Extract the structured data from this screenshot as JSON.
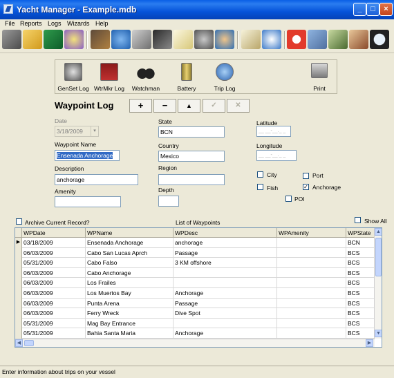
{
  "window": {
    "title": "Yacht Manager - Example.mdb",
    "minimize": "_",
    "maximize": "□",
    "close": "×"
  },
  "menu": [
    "File",
    "Reports",
    "Logs",
    "Wizards",
    "Help"
  ],
  "toolbar_icons": [
    "book-icon",
    "folder-icon",
    "save-icon",
    "star-icon",
    "brush-icon",
    "globe-icon",
    "tools-icon",
    "phone-icon",
    "notepad-icon",
    "engine-icon",
    "people-icon",
    "clipboard-icon",
    "clock-icon",
    "lifebuoy-icon",
    "printer-icon",
    "cash-icon",
    "house-icon",
    "magnifier-icon"
  ],
  "subtoolbar": [
    {
      "label": "GenSet Log",
      "icon": "genset-icon"
    },
    {
      "label": "WtrMkr Log",
      "icon": "watermaker-icon"
    },
    {
      "label": "Watchman",
      "icon": "binoculars-icon"
    },
    {
      "label": "Battery",
      "icon": "battery-icon"
    },
    {
      "label": "Trip Log",
      "icon": "globe-icon"
    },
    {
      "label": "Print",
      "icon": "printer-icon"
    }
  ],
  "form": {
    "heading": "Waypoint Log",
    "nav": {
      "add": "+",
      "delete": "−",
      "up": "▲",
      "check": "✓",
      "cancel": "✕"
    },
    "date_label": "Date",
    "date_value": "3/18/2009",
    "waypoint_label": "Waypoint Name",
    "waypoint_value": "Ensenada Anchorage",
    "description_label": "Description",
    "description_value": "anchorage",
    "amenity_label": "Amenity",
    "amenity_value": "",
    "state_label": "State",
    "state_value": "BCN",
    "country_label": "Country",
    "country_value": "Mexico",
    "region_label": "Region",
    "region_value": "",
    "depth_label": "Depth",
    "depth_value": "",
    "latitude_label": "Latitude",
    "latitude_value": "__ __-__._ _",
    "longitude_label": "Longitude",
    "longitude_value": "__ __-__._ _",
    "checks": {
      "city": "City",
      "port": "Port",
      "fish": "Fish",
      "anchorage": "Anchorage",
      "poi": "POI",
      "anchorage_mark": "✓"
    }
  },
  "grid": {
    "archive_label": "Archive Current Record?",
    "title": "List of Waypoints",
    "show_all": "Show All",
    "columns": [
      "WPDate",
      "WPName",
      "WPDesc",
      "WPAmenity",
      "WPState"
    ],
    "current_marker": "▶",
    "rows": [
      [
        "03/18/2009",
        "Ensenada Anchorage",
        "anchorage",
        "",
        "BCN"
      ],
      [
        "06/03/2009",
        "Cabo San Lucas Aprch",
        "Passage",
        "",
        "BCS"
      ],
      [
        "05/31/2009",
        "Cabo Falso",
        "3 KM offshore",
        "",
        "BCS"
      ],
      [
        "06/03/2009",
        "Cabo Anchorage",
        "",
        "",
        "BCS"
      ],
      [
        "06/03/2009",
        "Los Frailes",
        "",
        "",
        "BCS"
      ],
      [
        "06/03/2009",
        "Los Muertos Bay",
        "Anchorage",
        "",
        "BCS"
      ],
      [
        "06/03/2009",
        "Punta Arena",
        "Passage",
        "",
        "BCS"
      ],
      [
        "06/03/2009",
        "Ferry Wreck",
        "Dive Spot",
        "",
        "BCS"
      ],
      [
        "05/31/2009",
        "Mag Bay Entrance",
        "",
        "",
        "BCS"
      ],
      [
        "05/31/2009",
        "Bahia Santa Maria",
        "Anchorage",
        "",
        "BCS"
      ]
    ]
  },
  "status": "Enter information about trips on your vessel"
}
